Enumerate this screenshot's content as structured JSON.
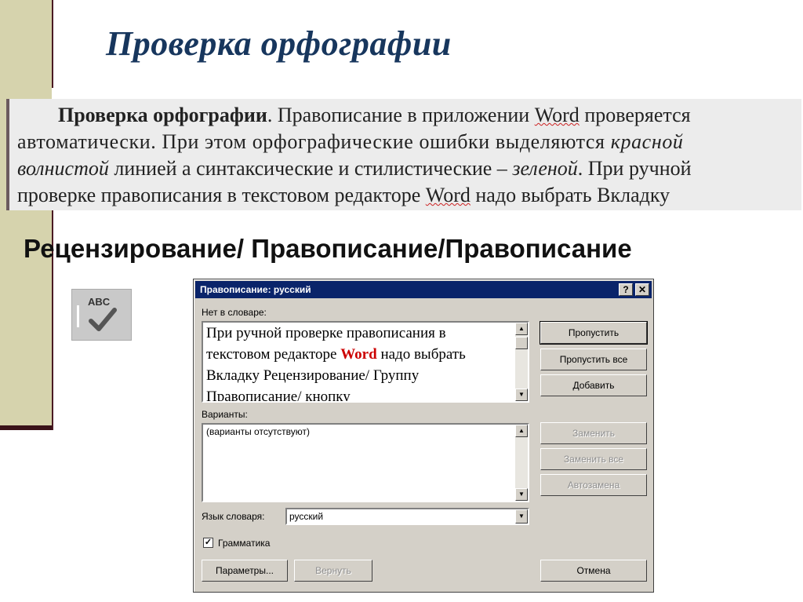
{
  "slide": {
    "title": "Проверка орфографии",
    "paragraph": {
      "line1_bold": "Проверка орфографии",
      "line1_rest": ". Правописание в приложении ",
      "line1_word": "Word",
      "line1_end": " проверяется",
      "line2_text": "автоматически. При этом орфографические ошибки выделяются ",
      "line2_italic": "красной",
      "line3_italic": "волнистой",
      "line3_text": " линией а синтаксические и стилистические – ",
      "line3_italic2": "зеленой",
      "line3_end": ". При ручной",
      "line4_text": "проверке правописания в текстовом редакторе ",
      "line4_word": "Word",
      "line4_end": " надо выбрать Вкладку"
    },
    "path_heading": "Рецензирование/ Правописание/Правописание",
    "toolbar_icon": {
      "label": "ABC",
      "icon": "spellcheck-icon"
    }
  },
  "dialog": {
    "title": "Правописание: русский",
    "help_label": "?",
    "close_label": "✕",
    "not_in_dict_label": "Нет в словаре:",
    "not_in_dict_text_before": "При ручной проверке правописания в текстовом редакторе ",
    "not_in_dict_word": "Word",
    "not_in_dict_text_after": " надо выбрать Вкладку Рецензирование/ Группу Правописание/ кнопку",
    "variants_label": "Варианты:",
    "variants_text": "(варианты отсутствуют)",
    "language_label": "Язык словаря:",
    "language_value": "русский",
    "grammar_label": "Грамматика",
    "grammar_checked": true,
    "buttons": {
      "skip": "Пропустить",
      "skip_all": "Пропустить все",
      "add": "Добавить",
      "replace": "Заменить",
      "replace_all": "Заменить все",
      "autocorrect": "Автозамена",
      "options": "Параметры...",
      "undo": "Вернуть",
      "cancel": "Отмена"
    }
  }
}
